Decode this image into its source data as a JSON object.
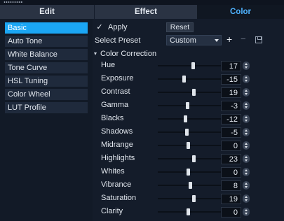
{
  "tabs": [
    {
      "label": "Edit",
      "active": false
    },
    {
      "label": "Effect",
      "active": false
    },
    {
      "label": "Color",
      "active": true
    }
  ],
  "sidebar": {
    "items": [
      {
        "label": "Basic",
        "active": true
      },
      {
        "label": "Auto Tone",
        "active": false
      },
      {
        "label": "White Balance",
        "active": false
      },
      {
        "label": "Tone Curve",
        "active": false
      },
      {
        "label": "HSL Tuning",
        "active": false
      },
      {
        "label": "Color Wheel",
        "active": false
      },
      {
        "label": "LUT Profile",
        "active": false
      }
    ]
  },
  "panel": {
    "apply_label": "Apply",
    "apply_checked": true,
    "reset_label": "Reset",
    "preset_label": "Select Preset",
    "preset_value": "Custom",
    "plus_icon": "+",
    "minus_icon": "−",
    "section_title": "Color Correction"
  },
  "sliders": [
    {
      "label": "Hue",
      "value": "17",
      "level": 0.55
    },
    {
      "label": "Exposure",
      "value": "-15",
      "level": 0.41
    },
    {
      "label": "Contrast",
      "value": "19",
      "level": 0.57
    },
    {
      "label": "Gamma",
      "value": "-3",
      "level": 0.47
    },
    {
      "label": "Blacks",
      "value": "-12",
      "level": 0.43
    },
    {
      "label": "Shadows",
      "value": "-5",
      "level": 0.45
    },
    {
      "label": "Midrange",
      "value": "0",
      "level": 0.48
    },
    {
      "label": "Highlights",
      "value": "23",
      "level": 0.57
    },
    {
      "label": "Whites",
      "value": "0",
      "level": 0.48
    },
    {
      "label": "Vibrance",
      "value": "8",
      "level": 0.51
    },
    {
      "label": "Saturation",
      "value": "19",
      "level": 0.57
    },
    {
      "label": "Clarity",
      "value": "0",
      "level": 0.48
    }
  ],
  "colors": {
    "accent": "#1ba6f4",
    "active_tab_text": "#4fb3ff"
  }
}
